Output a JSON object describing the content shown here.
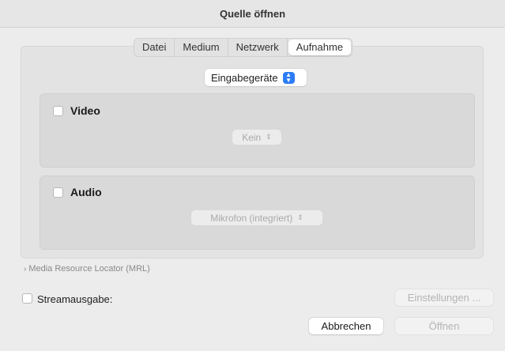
{
  "window": {
    "title": "Quelle öffnen"
  },
  "tabs": [
    {
      "label": "Datei",
      "active": false
    },
    {
      "label": "Medium",
      "active": false
    },
    {
      "label": "Netzwerk",
      "active": false
    },
    {
      "label": "Aufnahme",
      "active": true
    }
  ],
  "source_select": {
    "value": "Eingabegeräte",
    "icon": "updown-chevron-icon",
    "accent": "#2c7cf6"
  },
  "video": {
    "label": "Video",
    "checked": false,
    "device": "Kein"
  },
  "audio": {
    "label": "Audio",
    "checked": false,
    "device": "Mikrofon (integriert)"
  },
  "mrl": {
    "label": "Media Resource Locator (MRL)",
    "icon": "chevron-right-icon"
  },
  "stream": {
    "label": "Streamausgabe:",
    "checked": false,
    "settings_label": "Einstellungen ..."
  },
  "buttons": {
    "cancel": "Abbrechen",
    "open": "Öffnen"
  }
}
